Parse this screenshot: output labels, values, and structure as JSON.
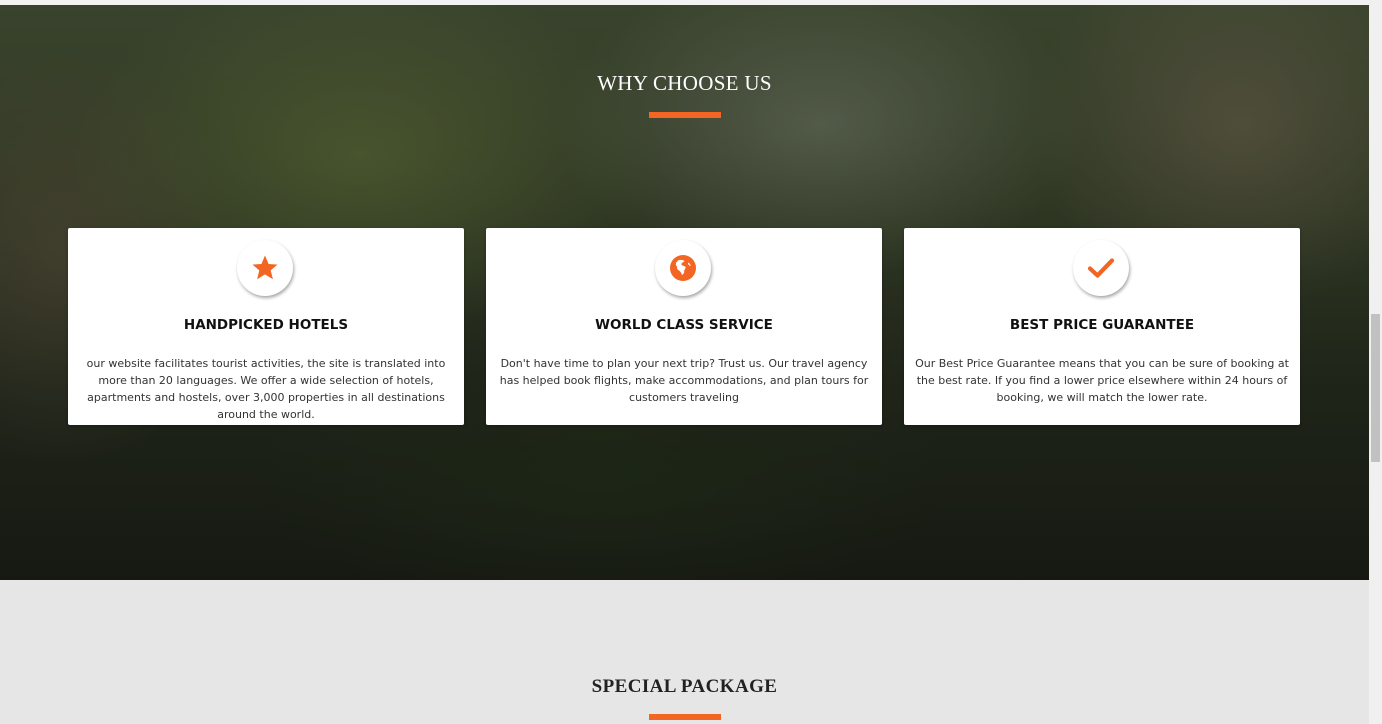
{
  "why_choose_us": {
    "title": "WHY CHOOSE US",
    "cards": [
      {
        "icon": "star-icon",
        "title": "HANDPICKED HOTELS",
        "text": "our website facilitates tourist activities, the site is translated into more than 20 languages. We offer a wide selection of hotels, apartments and hostels, over 3,000 properties in all destinations around the world."
      },
      {
        "icon": "globe-icon",
        "title": "WORLD CLASS SERVICE",
        "text": "Don't have time to plan your next trip? Trust us. Our travel agency has helped book flights, make accommodations, and plan tours for customers traveling"
      },
      {
        "icon": "checkmark-icon",
        "title": "BEST PRICE GUARANTEE",
        "text": "Our Best Price Guarantee means that you can be sure of booking at the best rate. If you find a lower price elsewhere within 24 hours of booking, we will match the lower rate."
      }
    ]
  },
  "special_package": {
    "title": "SPECIAL PACKAGE"
  },
  "colors": {
    "accent": "#f26522",
    "section_background": "#e6e6e6",
    "card_background": "#ffffff"
  }
}
